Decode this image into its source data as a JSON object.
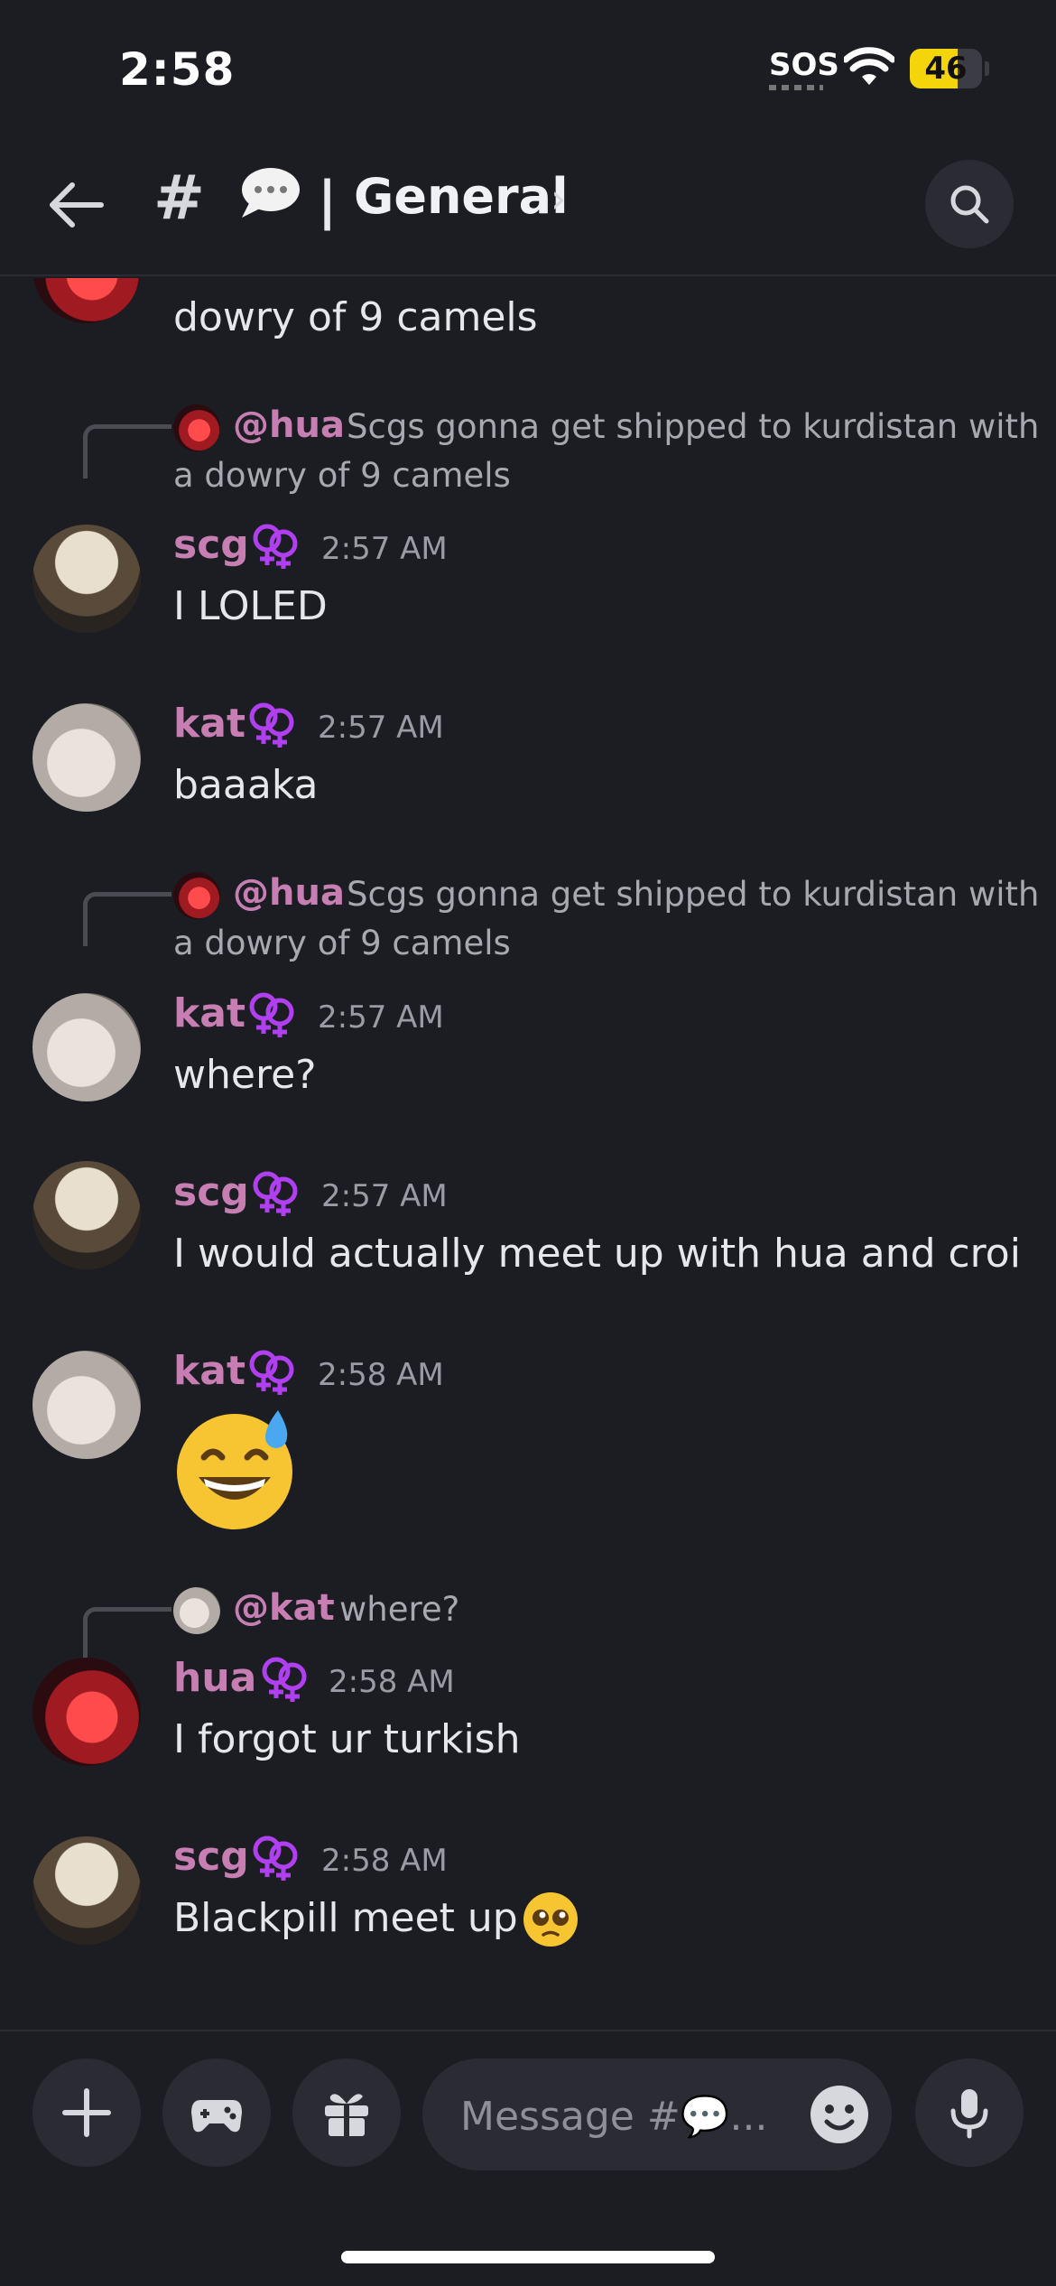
{
  "status_bar": {
    "time": "2:58",
    "sos": "SOS",
    "battery": "46"
  },
  "header": {
    "hash": "#",
    "channel_emoji": "speech-balloon",
    "separator": "|",
    "channel_name": "General",
    "chevron": "›"
  },
  "messages": {
    "prev_tail": "dowry of 9 camels",
    "reply1": {
      "mention": "@hua",
      "text": "Scgs gonna get shipped to kurdistan with",
      "text_cont": "a dowry of 9 camels"
    },
    "m1": {
      "author": "scg",
      "time": "2:57 AM",
      "text": "I LOLED"
    },
    "m2": {
      "author": "kat",
      "time": "2:57 AM",
      "text": "baaaka"
    },
    "reply2": {
      "mention": "@hua",
      "text": "Scgs gonna get shipped to kurdistan with",
      "text_cont": "a dowry of 9 camels"
    },
    "m3": {
      "author": "kat",
      "time": "2:57 AM",
      "text": "where?"
    },
    "m4": {
      "author": "scg",
      "time": "2:57 AM",
      "text": "I would actually meet up with hua and croi"
    },
    "m5": {
      "author": "kat",
      "time": "2:58 AM",
      "emoji": "grinning-face-with-sweat"
    },
    "reply3": {
      "mention": "@kat",
      "text": "where?"
    },
    "m6": {
      "author": "hua",
      "time": "2:58 AM",
      "text": "I forgot ur turkish"
    },
    "m7": {
      "author": "scg",
      "time": "2:58 AM",
      "text": "Blackpill meet up",
      "emoji": "pleading-face"
    }
  },
  "composer": {
    "placeholder": "Message #💬..."
  },
  "colors": {
    "background": "#1c1d23",
    "author": "#c77fb3",
    "badge": "#b03ff0",
    "surface": "#2b2c33"
  },
  "icons": [
    "back-arrow-icon",
    "search-icon",
    "plus-icon",
    "gamepad-icon",
    "gift-icon",
    "emoji-icon",
    "microphone-icon",
    "female-pair-icon"
  ]
}
